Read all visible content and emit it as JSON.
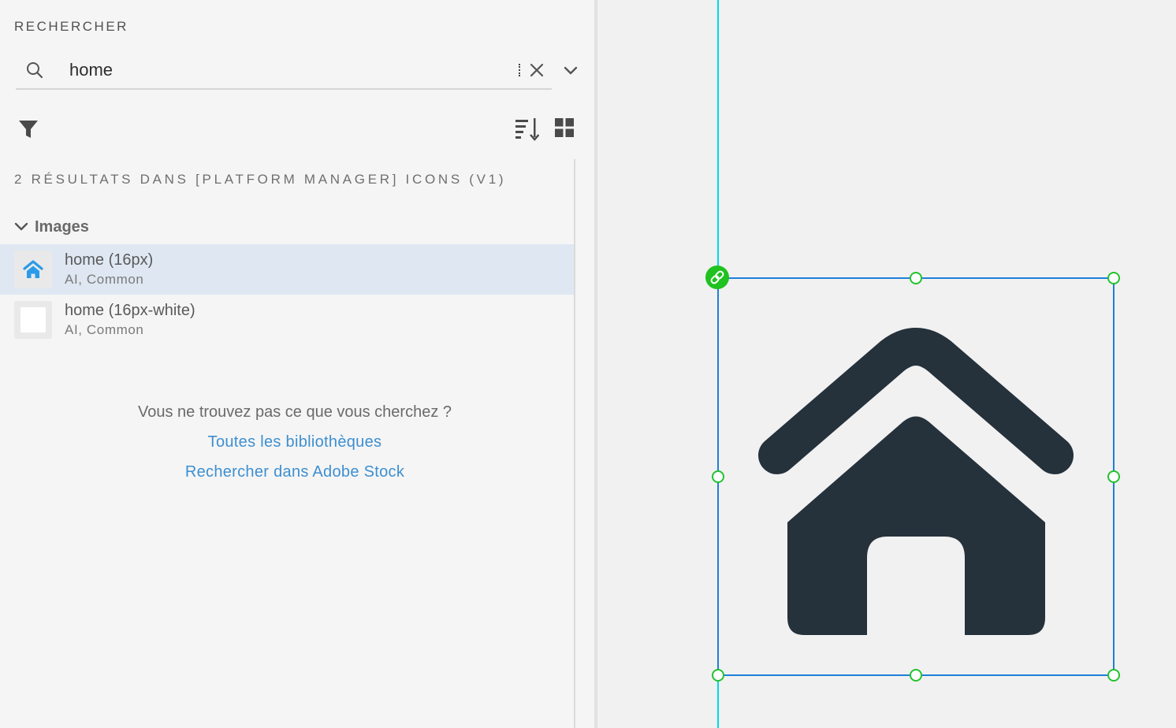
{
  "panel": {
    "title": "RECHERCHER",
    "search": {
      "value": "home",
      "placeholder": ""
    },
    "results_summary": "2 RÉSULTATS DANS [PLATFORM MANAGER] ICONS (V1)",
    "section": {
      "label": "Images"
    },
    "items": [
      {
        "title": "home (16px)",
        "subtitle": "AI, Common",
        "selected": true
      },
      {
        "title": "home (16px-white)",
        "subtitle": "AI, Common",
        "selected": false
      }
    ],
    "not_found_text": "Vous ne trouvez pas ce que vous cherchez ?",
    "links": {
      "all_libraries": "Toutes les bibliothèques",
      "adobe_stock": "Rechercher dans Adobe Stock"
    }
  },
  "colors": {
    "accent_link": "#3d8fd1",
    "selected_row": "#dfe8f2",
    "guide_line": "#00d8e8",
    "selection_box": "#1e7fd8",
    "handle": "#22c22e",
    "house_fill": "#25313b",
    "thumb_icon": "#2a9be8"
  },
  "icons": [
    "search-icon",
    "clear-icon",
    "chevron-down-icon",
    "filter-icon",
    "sort-icon",
    "grid-view-icon",
    "link-icon",
    "house-icon"
  ]
}
